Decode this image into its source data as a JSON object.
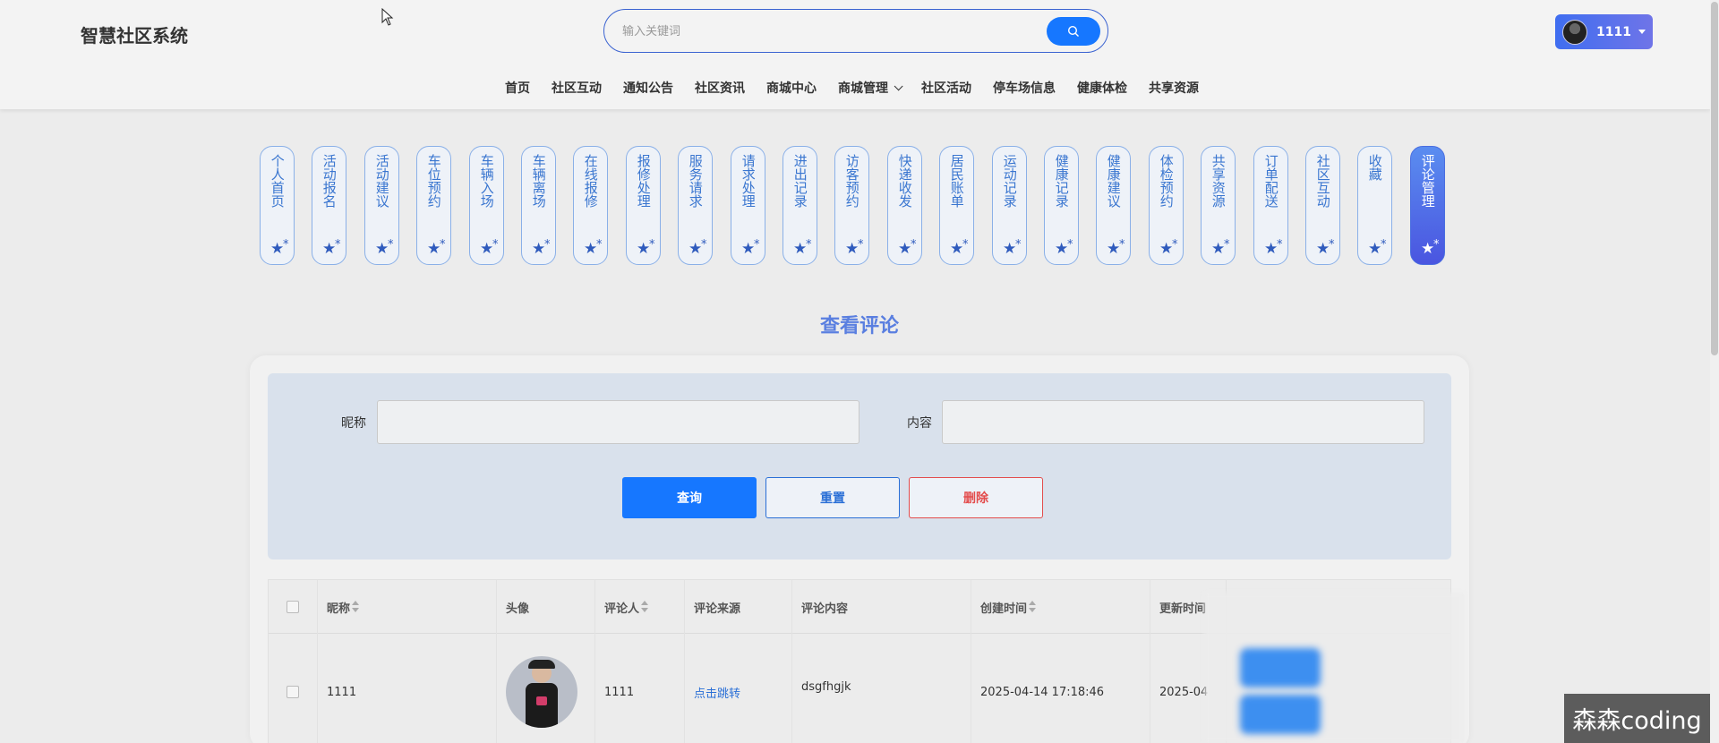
{
  "header": {
    "logo": "智慧社区系统",
    "search_placeholder": "输入关键词",
    "user_name": "1111"
  },
  "nav": [
    {
      "label": "首页",
      "dropdown": false
    },
    {
      "label": "社区互动",
      "dropdown": false
    },
    {
      "label": "通知公告",
      "dropdown": false
    },
    {
      "label": "社区资讯",
      "dropdown": false
    },
    {
      "label": "商城中心",
      "dropdown": false
    },
    {
      "label": "商城管理",
      "dropdown": true
    },
    {
      "label": "社区活动",
      "dropdown": false
    },
    {
      "label": "停车场信息",
      "dropdown": false
    },
    {
      "label": "健康体检",
      "dropdown": false
    },
    {
      "label": "共享资源",
      "dropdown": false
    }
  ],
  "side_tabs": [
    {
      "label": "个人首页",
      "active": false
    },
    {
      "label": "活动报名",
      "active": false
    },
    {
      "label": "活动建议",
      "active": false
    },
    {
      "label": "车位预约",
      "active": false
    },
    {
      "label": "车辆入场",
      "active": false
    },
    {
      "label": "车辆离场",
      "active": false
    },
    {
      "label": "在线报修",
      "active": false
    },
    {
      "label": "报修处理",
      "active": false
    },
    {
      "label": "服务请求",
      "active": false
    },
    {
      "label": "请求处理",
      "active": false
    },
    {
      "label": "进出记录",
      "active": false
    },
    {
      "label": "访客预约",
      "active": false
    },
    {
      "label": "快递收发",
      "active": false
    },
    {
      "label": "居民账单",
      "active": false
    },
    {
      "label": "运动记录",
      "active": false
    },
    {
      "label": "健康记录",
      "active": false
    },
    {
      "label": "健康建议",
      "active": false
    },
    {
      "label": "体检预约",
      "active": false
    },
    {
      "label": "共享资源",
      "active": false
    },
    {
      "label": "订单配送",
      "active": false
    },
    {
      "label": "社区互动",
      "active": false
    },
    {
      "label": "收藏",
      "active": false
    },
    {
      "label": "评论管理",
      "active": true
    }
  ],
  "page_title": "查看评论",
  "filter": {
    "nickname_label": "昵称",
    "nickname_value": "",
    "content_label": "内容",
    "content_value": "",
    "query_label": "查询",
    "reset_label": "重置",
    "delete_label": "删除"
  },
  "table": {
    "columns": [
      "昵称",
      "头像",
      "评论人",
      "评论来源",
      "评论内容",
      "创建时间",
      "更新时间"
    ],
    "rows": [
      {
        "nickname": "1111",
        "commenter": "1111",
        "source": "点击跳转",
        "content": "dsgfhgjk",
        "created": "2025-04-14 17:18:46",
        "updated": "2025-04"
      }
    ]
  },
  "watermark": "森森coding",
  "colors": {
    "primary": "#1677ff",
    "danger": "#e34c4c",
    "accent_title": "#5a7fe0",
    "tab_border": "#8ab0e8"
  }
}
